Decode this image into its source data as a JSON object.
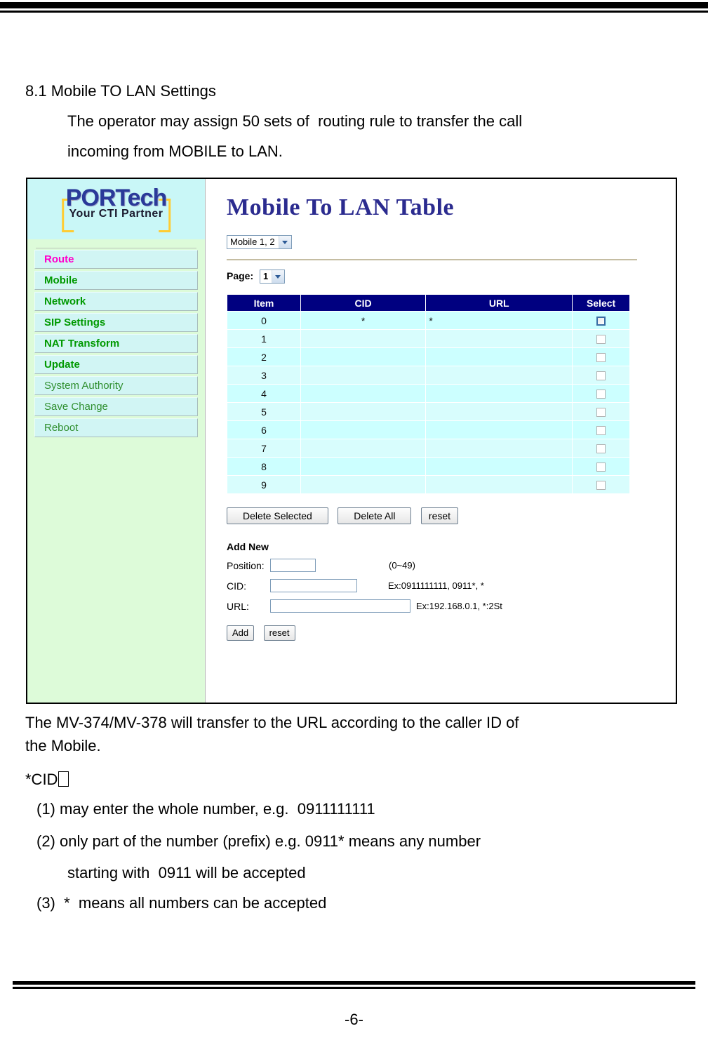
{
  "document": {
    "section_number_title": "8.1 Mobile TO LAN Settings",
    "intro_line_1": "The operator may assign 50 sets of  routing rule to transfer the call",
    "intro_line_2": "incoming from MOBILE to LAN.",
    "after_line_1": "The MV-374/MV-378 will transfer to the URL according to the caller ID of",
    "after_line_2": "the Mobile.",
    "cid_heading": "*CID",
    "note_1": "(1) may enter the whole number, e.g.  0911111111",
    "note_2": "(2) only part of the number (prefix) e.g. 0911*  means any number",
    "note_2b": "starting with  0911 will be accepted",
    "note_3": "(3)  *  means all numbers can be accepted",
    "page_number": "-6-"
  },
  "screenshot": {
    "logo": {
      "brand": "PORTech",
      "tagline": "Your CTI Partner"
    },
    "sidebar": {
      "items": [
        {
          "label": "Route",
          "state": "active"
        },
        {
          "label": "Mobile",
          "state": "normal"
        },
        {
          "label": "Network",
          "state": "normal"
        },
        {
          "label": "SIP Settings",
          "state": "normal"
        },
        {
          "label": "NAT Transform",
          "state": "normal"
        },
        {
          "label": "Update",
          "state": "normal"
        },
        {
          "label": "System Authority",
          "state": "plain"
        },
        {
          "label": "Save Change",
          "state": "plain"
        },
        {
          "label": "Reboot",
          "state": "plain"
        }
      ]
    },
    "main": {
      "title": "Mobile To LAN Table",
      "mobile_select": {
        "value": "Mobile 1, 2"
      },
      "page_label": "Page:",
      "page_select": {
        "value": "1"
      },
      "table": {
        "headers": [
          "Item",
          "CID",
          "URL",
          "Select"
        ],
        "rows": [
          {
            "item": "0",
            "cid": "*",
            "url": "*",
            "checked": false,
            "focused": true
          },
          {
            "item": "1",
            "cid": "",
            "url": "",
            "checked": false,
            "focused": false
          },
          {
            "item": "2",
            "cid": "",
            "url": "",
            "checked": false,
            "focused": false
          },
          {
            "item": "3",
            "cid": "",
            "url": "",
            "checked": false,
            "focused": false
          },
          {
            "item": "4",
            "cid": "",
            "url": "",
            "checked": false,
            "focused": false
          },
          {
            "item": "5",
            "cid": "",
            "url": "",
            "checked": false,
            "focused": false
          },
          {
            "item": "6",
            "cid": "",
            "url": "",
            "checked": false,
            "focused": false
          },
          {
            "item": "7",
            "cid": "",
            "url": "",
            "checked": false,
            "focused": false
          },
          {
            "item": "8",
            "cid": "",
            "url": "",
            "checked": false,
            "focused": false
          },
          {
            "item": "9",
            "cid": "",
            "url": "",
            "checked": false,
            "focused": false
          }
        ]
      },
      "buttons": {
        "delete_selected": "Delete Selected",
        "delete_all": "Delete All",
        "reset_top": "reset",
        "add": "Add",
        "reset_bottom": "reset"
      },
      "add_new": {
        "heading": "Add New",
        "position_label": "Position:",
        "position_value": "",
        "position_hint": "(0~49)",
        "cid_label": "CID:",
        "cid_value": "",
        "cid_hint": "Ex:0911111111,  0911*,  *",
        "url_label": "URL:",
        "url_value": "",
        "url_hint": "Ex:192.168.0.1,  *:2St"
      }
    },
    "colors": {
      "title_blue": "#2b2b8f",
      "table_header_navy": "#000080",
      "table_row_cyan": "#ccffff",
      "sidebar_green": "#ddfbd9",
      "logo_panel_cyan": "#c9f7f7",
      "nav_label_green": "#009900",
      "nav_active_magenta": "#ff00cc",
      "logo_blue": "#2a3a99",
      "logo_bracket_yellow": "#ffcc33",
      "rule_tan": "#c5bda2"
    }
  }
}
